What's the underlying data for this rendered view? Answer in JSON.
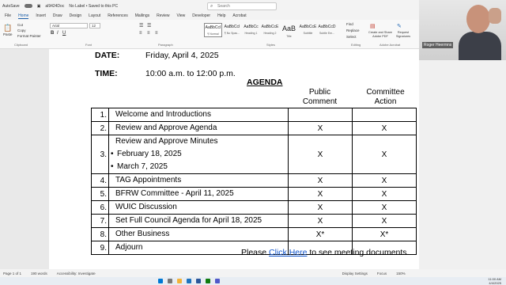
{
  "titlebar": {
    "autosave_label": "AutoSave",
    "doc_name": "al9424Doc",
    "label_status": "No Label • Saved to this PC",
    "search_placeholder": "Search"
  },
  "menu": [
    "File",
    "Home",
    "Insert",
    "Draw",
    "Design",
    "Layout",
    "References",
    "Mailings",
    "Review",
    "View",
    "Developer",
    "Help",
    "Acrobat"
  ],
  "ribbon": {
    "paste_label": "Paste",
    "cut_label": "Cut",
    "copy_label": "Copy",
    "format_painter_label": "Format Painter",
    "clipboard_group": "Clipboard",
    "font_name": "Arial",
    "font_size": "12",
    "font_group": "Font",
    "paragraph_group": "Paragraph",
    "styles_group": "Styles",
    "styles": [
      {
        "sample": "AaBbCcI",
        "name": "¶ Normal"
      },
      {
        "sample": "AaBbCcI",
        "name": "¶ No Spac..."
      },
      {
        "sample": "AaBbCc",
        "name": "Heading 1"
      },
      {
        "sample": "AaBbCcE",
        "name": "Heading 2"
      },
      {
        "sample": "AaB",
        "name": "Title"
      },
      {
        "sample": "AaBbCcE",
        "name": "Subtitle"
      },
      {
        "sample": "AaBbCcD",
        "name": "Subtle Em..."
      }
    ],
    "find_label": "Find",
    "replace_label": "Replace",
    "select_label": "Select",
    "editing_group": "Editing",
    "acrobat_create_label": "Create and Share Adobe PDF",
    "acrobat_request_label": "Request Signatures",
    "acrobat_group": "Adobe Acrobat"
  },
  "document": {
    "date_label": "DATE:",
    "date_value": "Friday, April 4, 2025",
    "time_label": "TIME:",
    "time_value": "10:00 a.m. to 12:00 p.m.",
    "agenda_title": "AGENDA",
    "col_public": [
      "Public",
      "Comment"
    ],
    "col_committee": [
      "Committee",
      "Action"
    ],
    "rows": [
      {
        "num": "1.",
        "item": "Welcome and Introductions",
        "public": "",
        "committee": ""
      },
      {
        "num": "2.",
        "item": "Review and Approve Agenda",
        "public": "X",
        "committee": "X"
      },
      {
        "num": "3.",
        "item": "Review and Approve Minutes",
        "public": "X",
        "committee": "X",
        "subitems": [
          "February 18, 2025",
          "March 7, 2025"
        ]
      },
      {
        "num": "4.",
        "item": "TAG Appointments",
        "public": "X",
        "committee": "X"
      },
      {
        "num": "5.",
        "item": "BFRW Committee - April 11, 2025",
        "public": "X",
        "committee": "X"
      },
      {
        "num": "6.",
        "item": "WUIC Discussion",
        "public": "X",
        "committee": "X"
      },
      {
        "num": "7.",
        "item": "Set Full Council Agenda for April 18, 2025",
        "public": "X",
        "committee": "X"
      },
      {
        "num": "8.",
        "item": "Other Business",
        "public": "X*",
        "committee": "X*"
      },
      {
        "num": "9.",
        "item": "Adjourn",
        "public": "",
        "committee": ""
      }
    ],
    "footer_prefix": "Please ",
    "footer_link": "Click Here",
    "footer_suffix": " to see meeting documents."
  },
  "video": {
    "participant_name": "Roger Heermns"
  },
  "status": {
    "page": "Page 1 of 1",
    "words": "190 words",
    "accessibility": "Accessibility: Investigate",
    "display": "Display Settings",
    "focus": "Focus",
    "zoom": "150%"
  },
  "clock": {
    "time": "11:00 AM",
    "date": "4/4/2025"
  }
}
